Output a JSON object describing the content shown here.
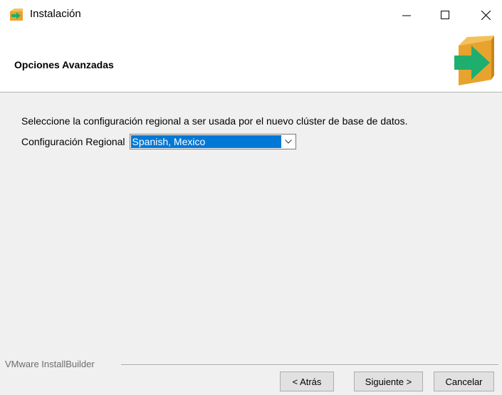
{
  "window": {
    "title": "Instalación",
    "icons": {
      "app": "installer-box-icon",
      "minimize": "minimize-icon",
      "maximize": "maximize-icon",
      "close": "close-icon"
    }
  },
  "header": {
    "heading": "Opciones Avanzadas",
    "logo_icon": "installer-box-arrow-icon"
  },
  "content": {
    "description": "Seleccione la configuración regional a ser usada por el nuevo clúster de base de datos.",
    "locale_label": "Configuración Regional",
    "locale_value": "Spanish, Mexico"
  },
  "footer": {
    "brand": "VMware InstallBuilder",
    "back_label": "< Atrás",
    "next_label": "Siguiente >",
    "cancel_label": "Cancelar"
  },
  "colors": {
    "selection": "#0078d7",
    "box_orange": "#e8a32e",
    "arrow_green": "#1fae6e"
  }
}
